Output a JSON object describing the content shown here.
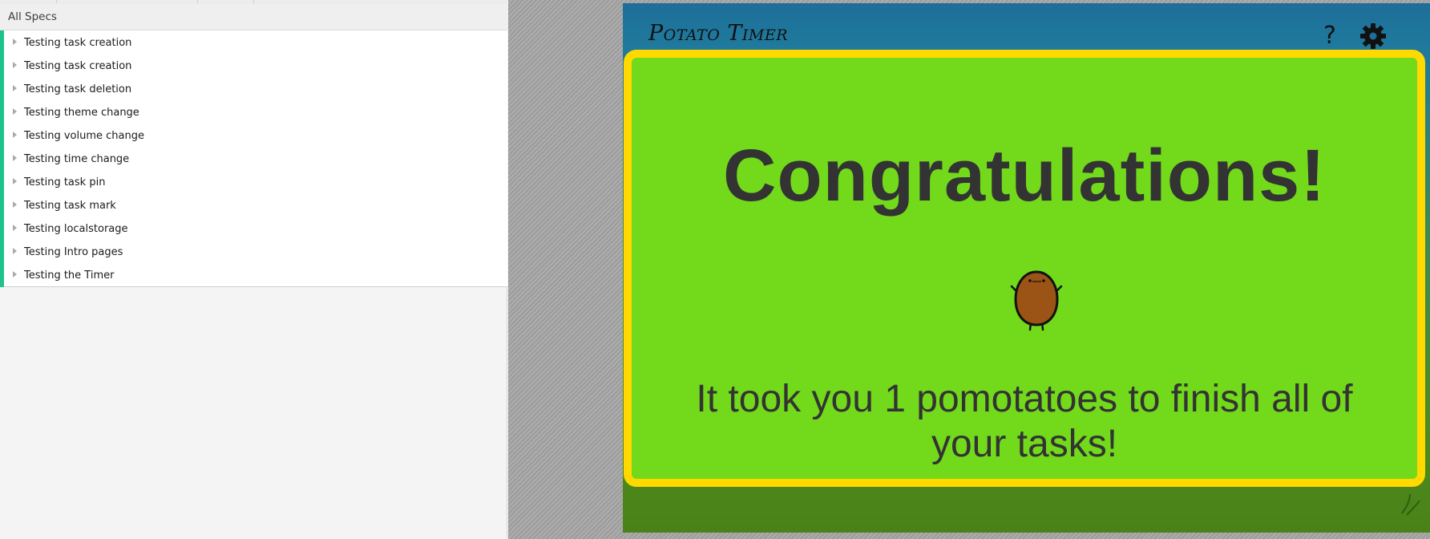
{
  "spec_panel": {
    "header": "All Specs",
    "items": [
      {
        "label": "Testing task creation"
      },
      {
        "label": "Testing task creation"
      },
      {
        "label": "Testing task deletion"
      },
      {
        "label": "Testing theme change"
      },
      {
        "label": "Testing volume change"
      },
      {
        "label": "Testing time change"
      },
      {
        "label": "Testing task pin"
      },
      {
        "label": "Testing task mark"
      },
      {
        "label": "Testing localstorage"
      },
      {
        "label": "Testing Intro pages"
      },
      {
        "label": "Testing the Timer"
      }
    ],
    "accent_color": "#1fc38a"
  },
  "app": {
    "title": "Potato Timer",
    "help_label": "?",
    "icons": {
      "help": "question-mark-icon",
      "settings": "gear-icon",
      "mascot": "potato-icon",
      "decoration": "grass-icon"
    },
    "colors": {
      "header": "#1e6e99",
      "ground": "#4a8218",
      "modal_bg": "#72d91b",
      "modal_border": "#ffd900",
      "text": "#333333"
    }
  },
  "modal": {
    "heading": "Congratulations!",
    "message": "It took you 1 pomotatoes to finish all of your tasks!"
  }
}
